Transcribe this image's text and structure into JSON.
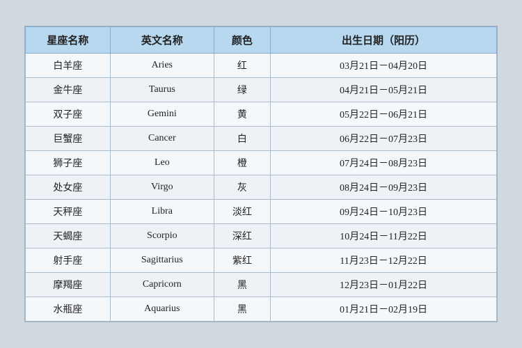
{
  "table": {
    "headers": [
      "星座名称",
      "英文名称",
      "颜色",
      "出生日期（阳历）"
    ],
    "rows": [
      {
        "cn": "白羊座",
        "en": "Aries",
        "color": "红",
        "date": "03月21日－04月20日"
      },
      {
        "cn": "金牛座",
        "en": "Taurus",
        "color": "绿",
        "date": "04月21日－05月21日"
      },
      {
        "cn": "双子座",
        "en": "Gemini",
        "color": "黄",
        "date": "05月22日－06月21日"
      },
      {
        "cn": "巨蟹座",
        "en": "Cancer",
        "color": "白",
        "date": "06月22日－07月23日"
      },
      {
        "cn": "狮子座",
        "en": "Leo",
        "color": "橙",
        "date": "07月24日－08月23日"
      },
      {
        "cn": "处女座",
        "en": "Virgo",
        "color": "灰",
        "date": "08月24日－09月23日"
      },
      {
        "cn": "天秤座",
        "en": "Libra",
        "color": "淡红",
        "date": "09月24日－10月23日"
      },
      {
        "cn": "天蝎座",
        "en": "Scorpio",
        "color": "深红",
        "date": "10月24日－11月22日"
      },
      {
        "cn": "射手座",
        "en": "Sagittarius",
        "color": "紫红",
        "date": "11月23日－12月22日"
      },
      {
        "cn": "摩羯座",
        "en": "Capricorn",
        "color": "黑",
        "date": "12月23日－01月22日"
      },
      {
        "cn": "水瓶座",
        "en": "Aquarius",
        "color": "黑",
        "date": "01月21日－02月19日"
      }
    ]
  }
}
